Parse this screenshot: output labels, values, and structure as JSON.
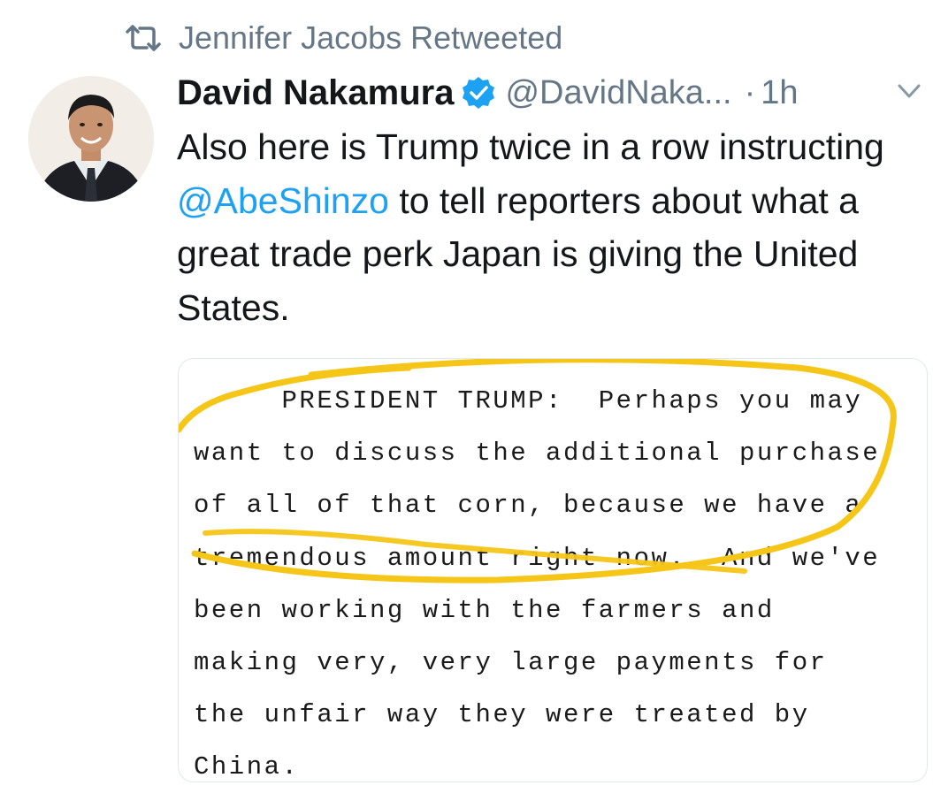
{
  "retweet": {
    "icon": "retweet-icon",
    "text": "Jennifer Jacobs Retweeted"
  },
  "tweet": {
    "avatar": "avatar-photo",
    "display_name": "David Nakamura",
    "verified_icon": "verified-badge-icon",
    "handle": "@DavidNaka...",
    "separator": "·",
    "time": "1h",
    "menu_icon": "chevron-down-icon",
    "text_parts": {
      "before_mention": "Also here is Trump twice in a row instructing ",
      "mention": "@AbeShinzo",
      "after_mention": " to tell reporters about what a great trade perk Japan is giving the United States."
    }
  },
  "media": {
    "type": "transcript-image",
    "highlight_color": "#f5c518",
    "lines": [
      "     PRESIDENT TRUMP:  Perhaps you may",
      "want to discuss the additional purchase",
      "of all of that corn, because we have a",
      "tremendous amount right now.  And we've",
      "been working with the farmers and",
      "making very, very large payments for",
      "the unfair way they were treated by",
      "China."
    ]
  },
  "colors": {
    "text_primary": "#14171a",
    "text_secondary": "#657786",
    "link": "#1da1f2",
    "verified": "#1da1f2",
    "highlight": "#f5c518"
  }
}
